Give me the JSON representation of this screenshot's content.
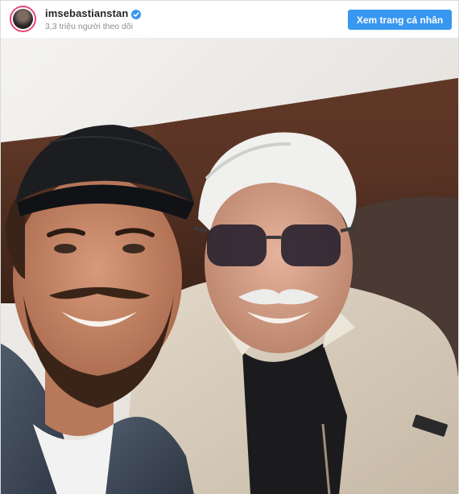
{
  "post": {
    "username": "imsebastianstan",
    "followers_text": "3,3 triệu người theo dõi",
    "profile_button_label": "Xem trang cá nhân",
    "verified": true
  },
  "icons": {
    "verified": "verified-badge-icon"
  },
  "colors": {
    "button_bg": "#3897f0",
    "verified_badge": "#3897f0",
    "avatar_ring": "#e8467a"
  }
}
